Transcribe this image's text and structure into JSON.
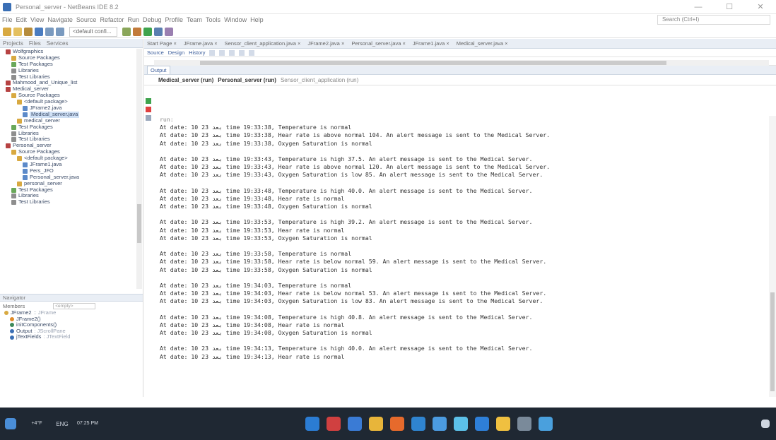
{
  "window": {
    "title": "Personal_server - NetBeans IDE 8.2",
    "controls": [
      "—",
      "☐",
      "✕"
    ]
  },
  "menu": {
    "items": [
      "File",
      "Edit",
      "View",
      "Navigate",
      "Source",
      "Refactor",
      "Run",
      "Debug",
      "Profile",
      "Team",
      "Tools",
      "Window",
      "Help"
    ],
    "search_placeholder": "Search (Ctrl+I)"
  },
  "toolbar": {
    "config_select": "<default confi..."
  },
  "projects": {
    "tabs": [
      "Projects",
      "Files",
      "Services"
    ],
    "tree": [
      {
        "label": "Wolfgraphics",
        "indent": 1,
        "color": "#b64242"
      },
      {
        "label": "Source Packages",
        "indent": 2,
        "color": "#d8a941"
      },
      {
        "label": "Test Packages",
        "indent": 2,
        "color": "#6aa85a"
      },
      {
        "label": "Libraries",
        "indent": 2,
        "color": "#8e8e8e"
      },
      {
        "label": "Test Libraries",
        "indent": 2,
        "color": "#8e8e8e"
      },
      {
        "label": "Mahmood_and_Unique_list",
        "indent": 1,
        "color": "#b64242"
      },
      {
        "label": "Medical_server",
        "indent": 1,
        "color": "#b64242"
      },
      {
        "label": "Source Packages",
        "indent": 2,
        "color": "#d8a941"
      },
      {
        "label": "<default package>",
        "indent": 3,
        "color": "#d8a941"
      },
      {
        "label": "JFrame2.java",
        "indent": 4,
        "color": "#5c8ac9"
      },
      {
        "label": "Medical_server.java",
        "indent": 4,
        "color": "#5c8ac9",
        "sel": true
      },
      {
        "label": "medical_server",
        "indent": 3,
        "color": "#d8a941"
      },
      {
        "label": "Test Packages",
        "indent": 2,
        "color": "#6aa85a"
      },
      {
        "label": "Libraries",
        "indent": 2,
        "color": "#8e8e8e"
      },
      {
        "label": "Test Libraries",
        "indent": 2,
        "color": "#8e8e8e"
      },
      {
        "label": "Personal_server",
        "indent": 1,
        "color": "#b64242"
      },
      {
        "label": "Source Packages",
        "indent": 2,
        "color": "#d8a941"
      },
      {
        "label": "<default package>",
        "indent": 3,
        "color": "#d8a941"
      },
      {
        "label": "JFrame1.java",
        "indent": 4,
        "color": "#5c8ac9"
      },
      {
        "label": "Pers_JFO",
        "indent": 4,
        "color": "#5c8ac9"
      },
      {
        "label": "Personal_server.java",
        "indent": 4,
        "color": "#5c8ac9"
      },
      {
        "label": "personal_server",
        "indent": 3,
        "color": "#d8a941"
      },
      {
        "label": "Test Packages",
        "indent": 2,
        "color": "#6aa85a"
      },
      {
        "label": "Libraries",
        "indent": 2,
        "color": "#8e8e8e"
      },
      {
        "label": "Test Libraries",
        "indent": 2,
        "color": "#8e8e8e"
      }
    ]
  },
  "navigator": {
    "header": "Navigator",
    "filter_label": "Members",
    "filter_value": "<empty>",
    "members": [
      {
        "label": "JFrame2",
        "sub": ":: JFrame",
        "color": "#d8a941"
      },
      {
        "label": "JFrame2()",
        "sub": "",
        "color": "#e08b2a"
      },
      {
        "label": "initComponents()",
        "sub": "",
        "color": "#3d8a5a"
      },
      {
        "label": "Output",
        "sub": ": JScrollPane",
        "color": "#3a6fb5"
      },
      {
        "label": "jTextFields",
        "sub": ": JTextField",
        "color": "#3a6fb5"
      }
    ]
  },
  "editor_tabs": [
    "Start Page",
    "JFrame.java",
    "Sensor_client_application.java",
    "JFrame2.java",
    "Personal_server.java",
    "JFrame1.java",
    "Medical_server.java"
  ],
  "editor_toolbar": {
    "source": "Source",
    "design": "Design",
    "history": "History"
  },
  "output": {
    "tab": "Output",
    "run_tabs": [
      "Medical_server (run)",
      "Personal_server (run)",
      "Sensor_client_application (run)"
    ],
    "initial": "run:",
    "groups": [
      [
        "At date: 10 23 بعد time 19:33:38, Temperature is normal",
        "At date: 10 23 بعد time 19:33:38, Hear rate is above normal 104. An alert message is sent to the Medical Server.",
        "At date: 10 23 بعد time 19:33:38, Oxygen Saturation is normal"
      ],
      [
        "At date: 10 23 بعد time 19:33:43, Temperature is high 37.5. An alert message is sent to the Medical Server.",
        "At date: 10 23 بعد time 19:33:43, Hear rate is above normal 120. An alert message is sent to the Medical Server.",
        "At date: 10 23 بعد time 19:33:43, Oxygen Saturation is low 85. An alert message is sent to the Medical Server."
      ],
      [
        "At date: 10 23 بعد time 19:33:48, Temperature is high 40.0. An alert message is sent to the Medical Server.",
        "At date: 10 23 بعد time 19:33:48, Hear rate is normal",
        "At date: 10 23 بعد time 19:33:48, Oxygen Saturation is normal"
      ],
      [
        "At date: 10 23 بعد time 19:33:53, Temperature is high 39.2. An alert message is sent to the Medical Server.",
        "At date: 10 23 بعد time 19:33:53, Hear rate is normal",
        "At date: 10 23 بعد time 19:33:53, Oxygen Saturation is normal"
      ],
      [
        "At date: 10 23 بعد time 19:33:58, Temperature is normal",
        "At date: 10 23 بعد time 19:33:58, Hear rate is below normal 59. An alert message is sent to the Medical Server.",
        "At date: 10 23 بعد time 19:33:58, Oxygen Saturation is normal"
      ],
      [
        "At date: 10 23 بعد time 19:34:03, Temperature is normal",
        "At date: 10 23 بعد time 19:34:03, Hear rate is below normal 53. An alert message is sent to the Medical Server.",
        "At date: 10 23 بعد time 19:34:03, Oxygen Saturation is low 83. An alert message is sent to the Medical Server."
      ],
      [
        "At date: 10 23 بعد time 19:34:08, Temperature is high 40.8. An alert message is sent to the Medical Server.",
        "At date: 10 23 بعد time 19:34:08, Hear rate is normal",
        "At date: 10 23 بعد time 19:34:08, Oxygen Saturation is normal"
      ],
      [
        "At date: 10 23 بعد time 19:34:13, Temperature is high 40.0. An alert message is sent to the Medical Server.",
        "At date: 10 23 بعد time 19:34:13, Hear rate is normal"
      ]
    ]
  },
  "taskbar": {
    "weather": "+4°F",
    "lang": "ENG",
    "time": "07:25 PM",
    "icons": [
      {
        "name": "edge-icon",
        "color": "#2b7cd3"
      },
      {
        "name": "store-icon",
        "color": "#d04040"
      },
      {
        "name": "mail-icon",
        "color": "#3a7bd5"
      },
      {
        "name": "chrome-icon",
        "color": "#e8b53a"
      },
      {
        "name": "firefox-icon",
        "color": "#e66a2c"
      },
      {
        "name": "vscode-icon",
        "color": "#2f84d0"
      },
      {
        "name": "check-icon",
        "color": "#4b9be0"
      },
      {
        "name": "photos-icon",
        "color": "#5cc0e8"
      },
      {
        "name": "calendar-icon",
        "color": "#2e7fd8"
      },
      {
        "name": "files-icon",
        "color": "#f0c040"
      },
      {
        "name": "terminal-icon",
        "color": "#7a8a9a"
      },
      {
        "name": "netbeans-icon",
        "color": "#4aa0dd"
      }
    ]
  }
}
